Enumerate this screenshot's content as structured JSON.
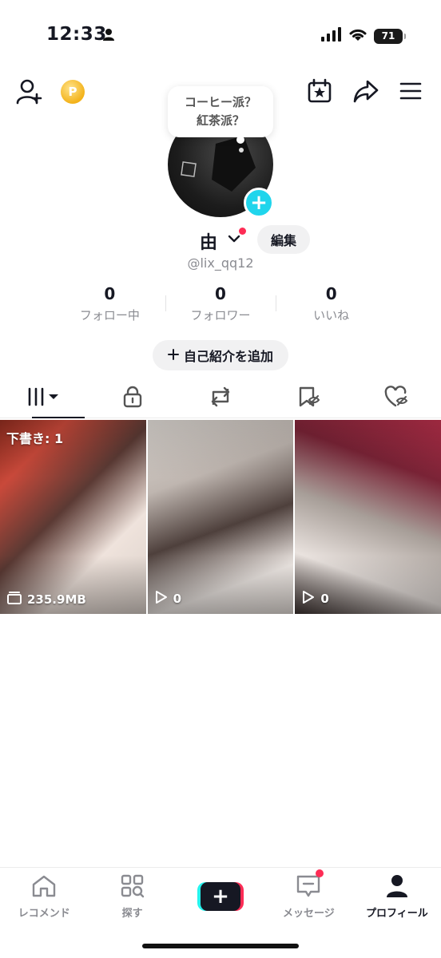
{
  "status_bar": {
    "time": "12:33",
    "battery": "71"
  },
  "speech_bubble": {
    "line1": "コーヒー派？",
    "line2": "紅茶派？"
  },
  "profile": {
    "display_name": "由",
    "edit_label": "編集",
    "username": "@lix_qq12",
    "add_bio_label": "自己紹介を追加"
  },
  "stats": [
    {
      "value": "0",
      "label": "フォロー中"
    },
    {
      "value": "0",
      "label": "フォロワー"
    },
    {
      "value": "0",
      "label": "いいね"
    }
  ],
  "videos": {
    "draft_label": "下書き: 1",
    "draft_size": "235.9MB",
    "views": [
      "0",
      "0"
    ]
  },
  "bottom_nav": {
    "items": [
      {
        "label": "レコメンド",
        "icon": "home-icon"
      },
      {
        "label": "探す",
        "icon": "discover-icon"
      },
      {
        "label": "",
        "icon": "create-icon"
      },
      {
        "label": "メッセージ",
        "icon": "inbox-icon"
      },
      {
        "label": "プロフィール",
        "icon": "profile-icon"
      }
    ]
  },
  "colors": {
    "accent_red": "#fe2c55",
    "accent_cyan": "#20d5ec",
    "text": "#161823",
    "muted": "#8a8b91"
  }
}
